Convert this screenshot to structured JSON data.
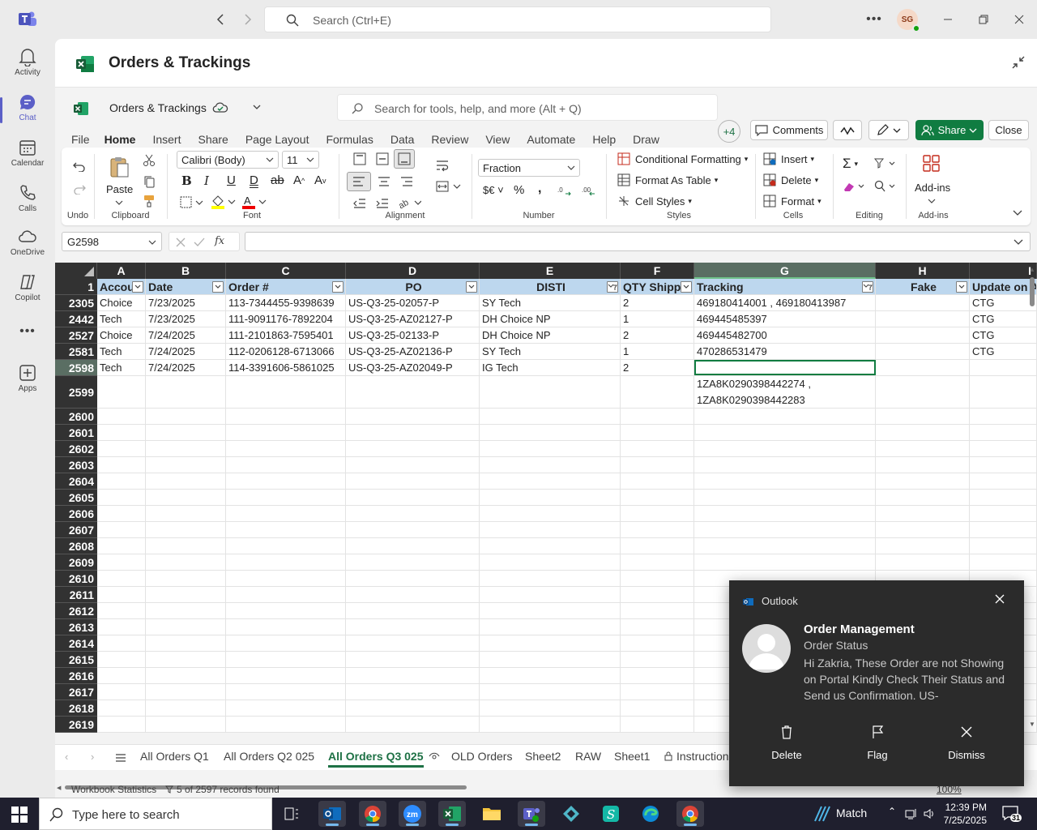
{
  "titlebar": {
    "search_placeholder": "Search (Ctrl+E)",
    "avatar_initials": "SG"
  },
  "rail": [
    {
      "label": "Activity",
      "icon": "bell-icon"
    },
    {
      "label": "Chat",
      "icon": "chat-icon",
      "active": true
    },
    {
      "label": "Calendar",
      "icon": "calendar-icon"
    },
    {
      "label": "Calls",
      "icon": "phone-icon"
    },
    {
      "label": "OneDrive",
      "icon": "cloud-icon"
    },
    {
      "label": "Copilot",
      "icon": "copilot-icon"
    },
    {
      "label": "",
      "icon": "more-icon"
    },
    {
      "label": "Apps",
      "icon": "apps-icon"
    }
  ],
  "app": {
    "title": "Orders & Trackings"
  },
  "excel": {
    "workbook_name": "Orders & Trackings",
    "tool_search_placeholder": "Search for tools, help, and more (Alt + Q)",
    "menus": [
      "File",
      "Home",
      "Insert",
      "Share",
      "Page Layout",
      "Formulas",
      "Data",
      "Review",
      "View",
      "Automate",
      "Help",
      "Draw"
    ],
    "active_menu": "Home",
    "more_tabs": "+4",
    "comments": "Comments",
    "share": "Share",
    "close": "Close",
    "ribbon": {
      "undo_label": "Undo",
      "clipboard_label": "Clipboard",
      "paste": "Paste",
      "font_name": "Calibri (Body)",
      "font_size": "11",
      "font_label": "Font",
      "alignment_label": "Alignment",
      "number_format": "Fraction",
      "number_label": "Number",
      "conditional_formatting": "Conditional Formatting",
      "format_as_table": "Format As Table",
      "cell_styles": "Cell Styles",
      "styles_label": "Styles",
      "insert": "Insert",
      "delete": "Delete",
      "format": "Format",
      "cells_label": "Cells",
      "editing_label": "Editing",
      "addins": "Add-ins",
      "addins_label": "Add-ins"
    },
    "name_box": "G2598",
    "columns": [
      {
        "letter": "A",
        "header": "Accou"
      },
      {
        "letter": "B",
        "header": "Date"
      },
      {
        "letter": "C",
        "header": "Order #"
      },
      {
        "letter": "D",
        "header": "PO"
      },
      {
        "letter": "E",
        "header": "DISTI"
      },
      {
        "letter": "F",
        "header": "QTY Shippe"
      },
      {
        "letter": "G",
        "header": "Tracking"
      },
      {
        "letter": "H",
        "header": "Fake"
      },
      {
        "letter": "I",
        "header": "Update on A"
      }
    ],
    "header_row_number": "1",
    "rows": [
      {
        "n": "2305",
        "cells": [
          "Choice",
          "7/23/2025",
          "113-7344455-9398639",
          "US-Q3-25-02057-P",
          "SY Tech",
          "2",
          "469180414001 , 469180413987",
          "",
          "CTG"
        ]
      },
      {
        "n": "2442",
        "cells": [
          "Tech",
          "7/23/2025",
          "111-9091176-7892204",
          "US-Q3-25-AZ02127-P",
          "DH Choice NP",
          "1",
          "469445485397",
          "",
          "CTG"
        ]
      },
      {
        "n": "2527",
        "cells": [
          "Choice",
          "7/24/2025",
          "111-2101863-7595401",
          "US-Q3-25-02133-P",
          "DH Choice NP",
          "2",
          "469445482700",
          "",
          "CTG"
        ]
      },
      {
        "n": "2581",
        "cells": [
          "Tech",
          "7/24/2025",
          "112-0206128-6713066",
          "US-Q3-25-AZ02136-P",
          "SY Tech",
          "1",
          "470286531479",
          "",
          "CTG"
        ]
      },
      {
        "n": "2598",
        "cells": [
          "Tech",
          "7/24/2025",
          "114-3391606-5861025",
          "US-Q3-25-AZ02049-P",
          "IG Tech",
          "2",
          "",
          "",
          ""
        ]
      },
      {
        "n": "2599",
        "cells": [
          "",
          "",
          "",
          "",
          "",
          "",
          "1ZA8K0290398442274 ,",
          "",
          ""
        ],
        "cont": "1ZA8K0290398442283"
      }
    ],
    "empty_rows": [
      "2600",
      "2601",
      "2602",
      "2603",
      "2604",
      "2605",
      "2606",
      "2607",
      "2608",
      "2609",
      "2610",
      "2611",
      "2612",
      "2613",
      "2614",
      "2615",
      "2616",
      "2617",
      "2618",
      "2619"
    ],
    "sheets": [
      "All Orders Q1",
      "All Orders Q2 025",
      "All Orders Q3 025",
      "OLD Orders",
      "Sheet2",
      "RAW",
      "Sheet1",
      "Instruction"
    ],
    "active_sheet": "All Orders Q3 025",
    "status": {
      "workbook_statistics": "Workbook Statistics",
      "records": "5 of 2597 records found",
      "zoom": "100%"
    }
  },
  "toast": {
    "app": "Outlook",
    "sender": "Order Management",
    "subject": "Order Status",
    "body": "Hi Zakria,  These Order are not Showing on Portal  Kindly Check Their Status and Send us Confirmation.   US-",
    "actions": [
      "Delete",
      "Flag",
      "Dismiss"
    ]
  },
  "taskbar": {
    "search_placeholder": "Type here to search",
    "weather": "Match",
    "time": "12:39 PM",
    "date": "7/25/2025",
    "notification_count": "31"
  },
  "colors": {
    "excel_green": "#107c41",
    "teams_purple": "#5b5fc7",
    "header_fill": "#bdd7ee"
  }
}
